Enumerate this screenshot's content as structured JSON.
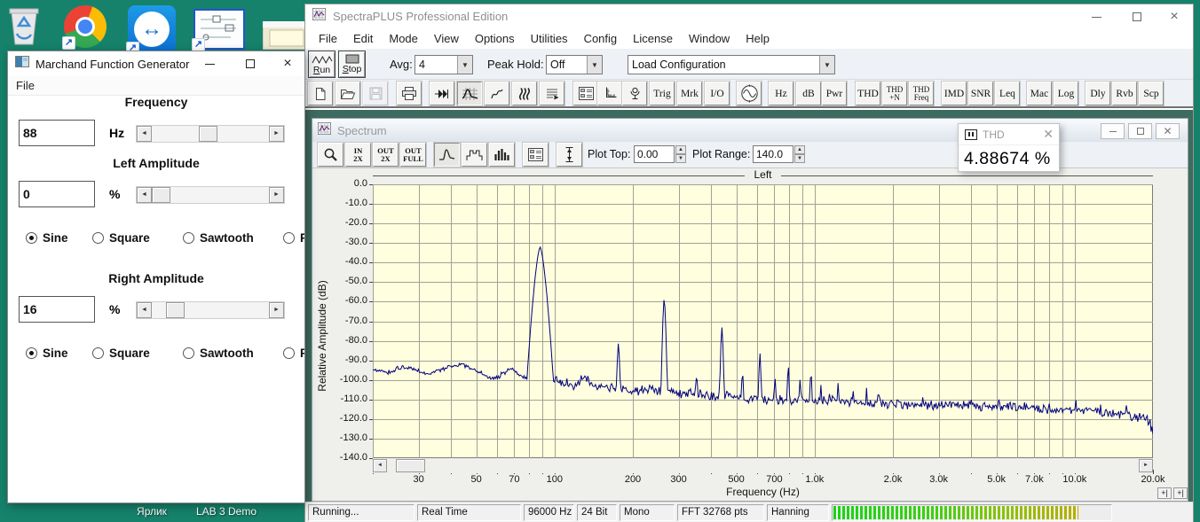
{
  "desktop": {
    "icons": [
      "recycle-bin",
      "chrome",
      "teamviewer",
      "circuit-schematic",
      "window-thumbnail"
    ],
    "icon_labels": [
      "Ярлик",
      "LAB 3 Demo"
    ]
  },
  "function_generator": {
    "title": "Marchand Function Generator",
    "menu": [
      "File"
    ],
    "frequency": {
      "heading": "Frequency",
      "value": "88",
      "unit": "Hz",
      "slider_pos": 0.47
    },
    "left_amplitude": {
      "heading": "Left Amplitude",
      "value": "0",
      "unit": "%",
      "slider_pos": 0.0
    },
    "right_amplitude": {
      "heading": "Right Amplitude",
      "value": "16",
      "unit": "%",
      "slider_pos": 0.14
    },
    "waveform_options": [
      "Sine",
      "Square",
      "Sawtooth",
      "P"
    ],
    "left_waveform_selected": "Sine",
    "right_waveform_selected": "Sine"
  },
  "app": {
    "title": "SpectraPLUS Professional Edition",
    "menu": [
      "File",
      "Edit",
      "Mode",
      "View",
      "Options",
      "Utilities",
      "Config",
      "License",
      "Window",
      "Help"
    ],
    "toolbar1": {
      "run_label": "Run",
      "stop_label": "Stop",
      "avg_label": "Avg:",
      "avg_value": "4",
      "peak_hold_label": "Peak Hold:",
      "peak_hold_value": "Off",
      "load_config_value": "Load Configuration"
    },
    "toolbar2": [
      {
        "name": "new-file-button",
        "icon": "page"
      },
      {
        "name": "open-file-button",
        "icon": "folder"
      },
      {
        "name": "save-button",
        "icon": "disk",
        "disabled": true
      },
      {
        "name": "print-button",
        "icon": "printer"
      },
      {
        "name": "run-all-button",
        "icon": "ffwd"
      },
      {
        "name": "spectrum-view-button",
        "icon": "spectrum",
        "selected": true
      },
      {
        "name": "waveform-view-button",
        "icon": "waveform"
      },
      {
        "name": "spectrogram-view-button",
        "icon": "spectrogram"
      },
      {
        "name": "report-view-button",
        "icon": "sheet"
      },
      {
        "name": "control-panel-button",
        "icon": "panel"
      },
      {
        "name": "scaling-button",
        "icon": "ruler"
      },
      {
        "name": "calibration-button",
        "icon": "mic"
      },
      {
        "name": "trigger-button",
        "label": "Trig"
      },
      {
        "name": "markers-button",
        "label": "Mrk"
      },
      {
        "name": "io-device-button",
        "label": "I/O"
      },
      {
        "name": "signal-generator-button",
        "icon": "generator"
      },
      {
        "name": "units-hz-button",
        "label": "Hz"
      },
      {
        "name": "units-db-button",
        "label": "dB"
      },
      {
        "name": "power-button",
        "label": "Pwr"
      },
      {
        "name": "thd-button",
        "label": "THD"
      },
      {
        "name": "thd-n-button",
        "lines": [
          "THD",
          "+N"
        ]
      },
      {
        "name": "thd-freq-button",
        "lines": [
          "THD",
          "Freq"
        ]
      },
      {
        "name": "imd-button",
        "label": "IMD"
      },
      {
        "name": "snr-button",
        "label": "SNR"
      },
      {
        "name": "leq-button",
        "label": "Leq"
      },
      {
        "name": "macro-button",
        "label": "Mac"
      },
      {
        "name": "logging-button",
        "label": "Log"
      },
      {
        "name": "delay-button",
        "label": "Dly"
      },
      {
        "name": "reverb-button",
        "label": "Rvb"
      },
      {
        "name": "scope-button",
        "label": "Scp"
      }
    ],
    "status": [
      "Running...",
      "Real Time",
      "96000 Hz",
      "24 Bit",
      "Mono",
      "FFT 32768 pts",
      "Hanning"
    ],
    "meter_fill": 0.88
  },
  "spectrum_window": {
    "title": "Spectrum",
    "toolbar": [
      {
        "name": "zoom-button",
        "icon": "magnifier"
      },
      {
        "name": "zoom-in-2x-button",
        "lines": [
          "IN",
          "2X"
        ]
      },
      {
        "name": "zoom-out-2x-button",
        "lines": [
          "OUT",
          "2X"
        ]
      },
      {
        "name": "zoom-out-full-button",
        "lines": [
          "OUT",
          "FULL"
        ]
      },
      {
        "name": "line-plot-mode-button",
        "icon": "linemode",
        "selected": true
      },
      {
        "name": "bar-plot-mode-button",
        "icon": "barmode"
      },
      {
        "name": "histogram-mode-button",
        "icon": "histmode"
      },
      {
        "name": "display-options-button",
        "icon": "panel"
      },
      {
        "name": "amplitude-scale-button",
        "icon": "vscale"
      }
    ],
    "plot_top_label": "Plot Top:",
    "plot_top_value": "0.00",
    "plot_range_label": "Plot Range:",
    "plot_range_value": "140.0"
  },
  "thd_overlay": {
    "title": "THD",
    "value": "4.88674 %"
  },
  "chart_data": {
    "type": "line",
    "title": "Left",
    "xlabel": "Frequency (Hz)",
    "ylabel": "Relative Amplitude (dB)",
    "x_scale": "log",
    "xlim": [
      20,
      20000
    ],
    "ylim": [
      -140,
      0
    ],
    "grid": true,
    "line_color": "#00007E",
    "plot_bg": "#FFFFDF",
    "y_ticks": [
      0,
      -10,
      -20,
      -30,
      -40,
      -50,
      -60,
      -70,
      -80,
      -90,
      -100,
      -110,
      -120,
      -130,
      -140
    ],
    "x_ticks": [
      {
        "f": 30,
        "label": "30"
      },
      {
        "f": 50,
        "label": "50"
      },
      {
        "f": 70,
        "label": "70"
      },
      {
        "f": 100,
        "label": "100"
      },
      {
        "f": 200,
        "label": "200"
      },
      {
        "f": 300,
        "label": "300"
      },
      {
        "f": 500,
        "label": "500"
      },
      {
        "f": 700,
        "label": "700"
      },
      {
        "f": 1000,
        "label": "1.0k"
      },
      {
        "f": 2000,
        "label": "2.0k"
      },
      {
        "f": 3000,
        "label": "3.0k"
      },
      {
        "f": 5000,
        "label": "5.0k"
      },
      {
        "f": 7000,
        "label": "7.0k"
      },
      {
        "f": 10000,
        "label": "10.0k"
      },
      {
        "f": 20000,
        "label": "20.0k"
      }
    ],
    "peaks": [
      {
        "f": 88,
        "db": -32,
        "w": 0.016
      },
      {
        "f": 176,
        "db": -81,
        "w": 0.005
      },
      {
        "f": 264,
        "db": -58,
        "w": 0.005
      },
      {
        "f": 352,
        "db": -96,
        "w": 0.004
      },
      {
        "f": 440,
        "db": -73,
        "w": 0.0045
      },
      {
        "f": 528,
        "db": -95,
        "w": 0.004
      },
      {
        "f": 616,
        "db": -86,
        "w": 0.004
      },
      {
        "f": 704,
        "db": -98,
        "w": 0.004
      },
      {
        "f": 792,
        "db": -92,
        "w": 0.004
      },
      {
        "f": 880,
        "db": -99,
        "w": 0.004
      },
      {
        "f": 968,
        "db": -95,
        "w": 0.004
      },
      {
        "f": 1056,
        "db": -102,
        "w": 0.004
      },
      {
        "f": 1144,
        "db": -105,
        "w": 0.004
      },
      {
        "f": 1232,
        "db": -101,
        "w": 0.004
      },
      {
        "f": 1410,
        "db": -105,
        "w": 0.004
      },
      {
        "f": 1584,
        "db": -104,
        "w": 0.004
      },
      {
        "f": 1760,
        "db": -104,
        "w": 0.004
      },
      {
        "f": 2100,
        "db": -107,
        "w": 0.004
      },
      {
        "f": 2600,
        "db": -108,
        "w": 0.004
      },
      {
        "f": 3200,
        "db": -108,
        "w": 0.004
      },
      {
        "f": 4000,
        "db": -110,
        "w": 0.004
      },
      {
        "f": 5100,
        "db": -109,
        "w": 0.004
      },
      {
        "f": 6400,
        "db": -111,
        "w": 0.004
      },
      {
        "f": 8000,
        "db": -111,
        "w": 0.004
      },
      {
        "f": 10100,
        "db": -110,
        "w": 0.004
      },
      {
        "f": 12600,
        "db": -112,
        "w": 0.004
      },
      {
        "f": 15800,
        "db": -113,
        "w": 0.004
      }
    ],
    "noise_floor": [
      [
        20,
        -95
      ],
      [
        23,
        -96
      ],
      [
        26,
        -93
      ],
      [
        29,
        -95
      ],
      [
        32,
        -97
      ],
      [
        36,
        -95
      ],
      [
        40,
        -93
      ],
      [
        44,
        -92
      ],
      [
        48,
        -94
      ],
      [
        53,
        -97
      ],
      [
        58,
        -100
      ],
      [
        63,
        -97
      ],
      [
        68,
        -94
      ],
      [
        72,
        -97
      ],
      [
        76,
        -99
      ],
      [
        82,
        -101
      ],
      [
        90,
        -101
      ],
      [
        100,
        -99
      ],
      [
        108,
        -101
      ],
      [
        118,
        -103
      ],
      [
        130,
        -99
      ],
      [
        145,
        -104
      ],
      [
        160,
        -103
      ],
      [
        180,
        -105
      ],
      [
        200,
        -106
      ],
      [
        230,
        -104
      ],
      [
        260,
        -106
      ],
      [
        300,
        -107
      ],
      [
        340,
        -106
      ],
      [
        400,
        -108
      ],
      [
        460,
        -108
      ],
      [
        530,
        -109
      ],
      [
        620,
        -110
      ],
      [
        720,
        -110
      ],
      [
        850,
        -110
      ],
      [
        1000,
        -111
      ],
      [
        1200,
        -111
      ],
      [
        1500,
        -112
      ],
      [
        1900,
        -112
      ],
      [
        2400,
        -113
      ],
      [
        3000,
        -113
      ],
      [
        3800,
        -113
      ],
      [
        4800,
        -114
      ],
      [
        6000,
        -114
      ],
      [
        7500,
        -115
      ],
      [
        9500,
        -115
      ],
      [
        12000,
        -116
      ],
      [
        15000,
        -117
      ],
      [
        18000,
        -119
      ],
      [
        19500,
        -122
      ],
      [
        20000,
        -127
      ]
    ],
    "noise_seed": 11,
    "thd_readout": "4.88674 %"
  }
}
